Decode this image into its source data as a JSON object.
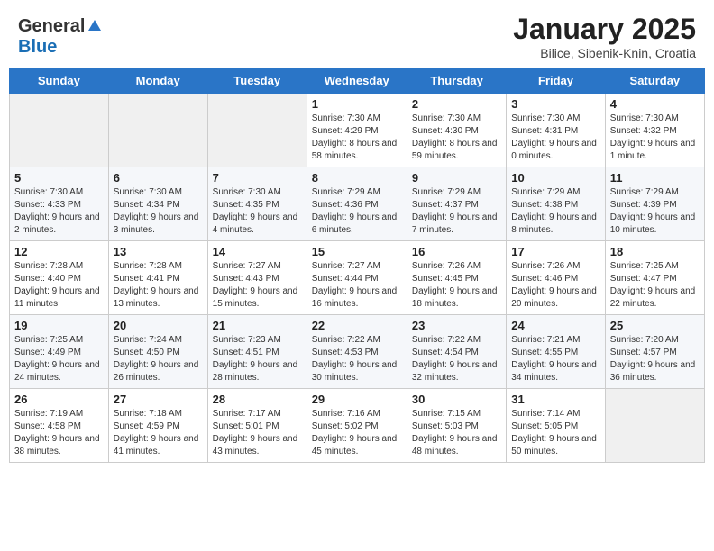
{
  "header": {
    "logo_general": "General",
    "logo_blue": "Blue",
    "title": "January 2025",
    "subtitle": "Bilice, Sibenik-Knin, Croatia"
  },
  "weekdays": [
    "Sunday",
    "Monday",
    "Tuesday",
    "Wednesday",
    "Thursday",
    "Friday",
    "Saturday"
  ],
  "weeks": [
    [
      {
        "day": "",
        "sunrise": "",
        "sunset": "",
        "daylight": ""
      },
      {
        "day": "",
        "sunrise": "",
        "sunset": "",
        "daylight": ""
      },
      {
        "day": "",
        "sunrise": "",
        "sunset": "",
        "daylight": ""
      },
      {
        "day": "1",
        "sunrise": "Sunrise: 7:30 AM",
        "sunset": "Sunset: 4:29 PM",
        "daylight": "Daylight: 8 hours and 58 minutes."
      },
      {
        "day": "2",
        "sunrise": "Sunrise: 7:30 AM",
        "sunset": "Sunset: 4:30 PM",
        "daylight": "Daylight: 8 hours and 59 minutes."
      },
      {
        "day": "3",
        "sunrise": "Sunrise: 7:30 AM",
        "sunset": "Sunset: 4:31 PM",
        "daylight": "Daylight: 9 hours and 0 minutes."
      },
      {
        "day": "4",
        "sunrise": "Sunrise: 7:30 AM",
        "sunset": "Sunset: 4:32 PM",
        "daylight": "Daylight: 9 hours and 1 minute."
      }
    ],
    [
      {
        "day": "5",
        "sunrise": "Sunrise: 7:30 AM",
        "sunset": "Sunset: 4:33 PM",
        "daylight": "Daylight: 9 hours and 2 minutes."
      },
      {
        "day": "6",
        "sunrise": "Sunrise: 7:30 AM",
        "sunset": "Sunset: 4:34 PM",
        "daylight": "Daylight: 9 hours and 3 minutes."
      },
      {
        "day": "7",
        "sunrise": "Sunrise: 7:30 AM",
        "sunset": "Sunset: 4:35 PM",
        "daylight": "Daylight: 9 hours and 4 minutes."
      },
      {
        "day": "8",
        "sunrise": "Sunrise: 7:29 AM",
        "sunset": "Sunset: 4:36 PM",
        "daylight": "Daylight: 9 hours and 6 minutes."
      },
      {
        "day": "9",
        "sunrise": "Sunrise: 7:29 AM",
        "sunset": "Sunset: 4:37 PM",
        "daylight": "Daylight: 9 hours and 7 minutes."
      },
      {
        "day": "10",
        "sunrise": "Sunrise: 7:29 AM",
        "sunset": "Sunset: 4:38 PM",
        "daylight": "Daylight: 9 hours and 8 minutes."
      },
      {
        "day": "11",
        "sunrise": "Sunrise: 7:29 AM",
        "sunset": "Sunset: 4:39 PM",
        "daylight": "Daylight: 9 hours and 10 minutes."
      }
    ],
    [
      {
        "day": "12",
        "sunrise": "Sunrise: 7:28 AM",
        "sunset": "Sunset: 4:40 PM",
        "daylight": "Daylight: 9 hours and 11 minutes."
      },
      {
        "day": "13",
        "sunrise": "Sunrise: 7:28 AM",
        "sunset": "Sunset: 4:41 PM",
        "daylight": "Daylight: 9 hours and 13 minutes."
      },
      {
        "day": "14",
        "sunrise": "Sunrise: 7:27 AM",
        "sunset": "Sunset: 4:43 PM",
        "daylight": "Daylight: 9 hours and 15 minutes."
      },
      {
        "day": "15",
        "sunrise": "Sunrise: 7:27 AM",
        "sunset": "Sunset: 4:44 PM",
        "daylight": "Daylight: 9 hours and 16 minutes."
      },
      {
        "day": "16",
        "sunrise": "Sunrise: 7:26 AM",
        "sunset": "Sunset: 4:45 PM",
        "daylight": "Daylight: 9 hours and 18 minutes."
      },
      {
        "day": "17",
        "sunrise": "Sunrise: 7:26 AM",
        "sunset": "Sunset: 4:46 PM",
        "daylight": "Daylight: 9 hours and 20 minutes."
      },
      {
        "day": "18",
        "sunrise": "Sunrise: 7:25 AM",
        "sunset": "Sunset: 4:47 PM",
        "daylight": "Daylight: 9 hours and 22 minutes."
      }
    ],
    [
      {
        "day": "19",
        "sunrise": "Sunrise: 7:25 AM",
        "sunset": "Sunset: 4:49 PM",
        "daylight": "Daylight: 9 hours and 24 minutes."
      },
      {
        "day": "20",
        "sunrise": "Sunrise: 7:24 AM",
        "sunset": "Sunset: 4:50 PM",
        "daylight": "Daylight: 9 hours and 26 minutes."
      },
      {
        "day": "21",
        "sunrise": "Sunrise: 7:23 AM",
        "sunset": "Sunset: 4:51 PM",
        "daylight": "Daylight: 9 hours and 28 minutes."
      },
      {
        "day": "22",
        "sunrise": "Sunrise: 7:22 AM",
        "sunset": "Sunset: 4:53 PM",
        "daylight": "Daylight: 9 hours and 30 minutes."
      },
      {
        "day": "23",
        "sunrise": "Sunrise: 7:22 AM",
        "sunset": "Sunset: 4:54 PM",
        "daylight": "Daylight: 9 hours and 32 minutes."
      },
      {
        "day": "24",
        "sunrise": "Sunrise: 7:21 AM",
        "sunset": "Sunset: 4:55 PM",
        "daylight": "Daylight: 9 hours and 34 minutes."
      },
      {
        "day": "25",
        "sunrise": "Sunrise: 7:20 AM",
        "sunset": "Sunset: 4:57 PM",
        "daylight": "Daylight: 9 hours and 36 minutes."
      }
    ],
    [
      {
        "day": "26",
        "sunrise": "Sunrise: 7:19 AM",
        "sunset": "Sunset: 4:58 PM",
        "daylight": "Daylight: 9 hours and 38 minutes."
      },
      {
        "day": "27",
        "sunrise": "Sunrise: 7:18 AM",
        "sunset": "Sunset: 4:59 PM",
        "daylight": "Daylight: 9 hours and 41 minutes."
      },
      {
        "day": "28",
        "sunrise": "Sunrise: 7:17 AM",
        "sunset": "Sunset: 5:01 PM",
        "daylight": "Daylight: 9 hours and 43 minutes."
      },
      {
        "day": "29",
        "sunrise": "Sunrise: 7:16 AM",
        "sunset": "Sunset: 5:02 PM",
        "daylight": "Daylight: 9 hours and 45 minutes."
      },
      {
        "day": "30",
        "sunrise": "Sunrise: 7:15 AM",
        "sunset": "Sunset: 5:03 PM",
        "daylight": "Daylight: 9 hours and 48 minutes."
      },
      {
        "day": "31",
        "sunrise": "Sunrise: 7:14 AM",
        "sunset": "Sunset: 5:05 PM",
        "daylight": "Daylight: 9 hours and 50 minutes."
      },
      {
        "day": "",
        "sunrise": "",
        "sunset": "",
        "daylight": ""
      }
    ]
  ]
}
